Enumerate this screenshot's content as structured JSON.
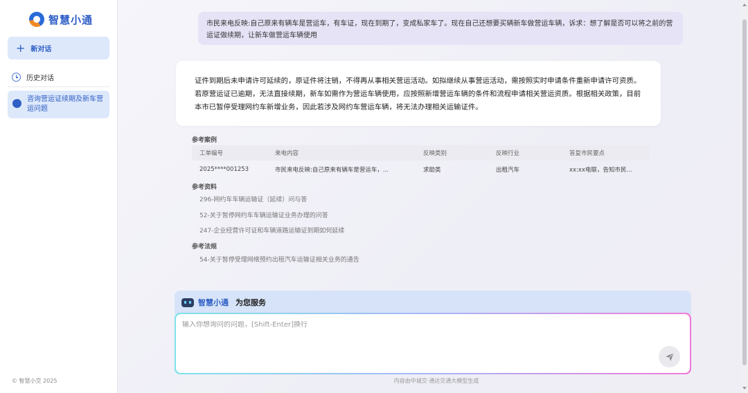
{
  "sidebar": {
    "logo_text": "智慧小通",
    "new_chat_label": "新对话",
    "history_label": "历史对话",
    "conversations": [
      {
        "label": "咨询营运证续期及新车营运问题"
      }
    ],
    "copyright": "© 智慧小交 2025"
  },
  "chat": {
    "user_message": "市民来电反映:自己原来有辆车是营运车，有车证，现在到期了，变成私家车了。现在自己还想要买辆新车做营运车辆，诉求：想了解是否可以将之前的营运证做续期，让新车做营运车辆使用",
    "ai_message": "证件到期后未申请许可延续的，原证件将注销，不得再从事相关营运活动。如拟继续从事营运活动，需按照实时申请条件重新申请许可资质。若原营运证已逾期，无法直接续期，新车如需作为营运车辆使用，应按照新增营运车辆的条件和流程申请相关营运资质。根据相关政策，目前本市已暂停受理网约车新增业务，因此若涉及网约车营运车辆，将无法办理相关运输证件。"
  },
  "references": {
    "cases_title": "参考案例",
    "table_headers": [
      "工单编号",
      "来电内容",
      "反映类别",
      "反映行业",
      "答复市民要点"
    ],
    "table_rows": [
      [
        "2025****001253",
        "市民来电反映:自己原来有辆车是营运车，...",
        "求助类",
        "出租汽车",
        "xx:xx电联，告知市民..."
      ]
    ],
    "materials_title": "参考资料",
    "materials": [
      "296-网约车车辆运输证（延续）问与答",
      "52-关于暂停网约车车辆运输证业务办理的问答",
      "247-企业经营许可证和车辆道路运输证到期如何延续"
    ],
    "regulations_title": "参考法规",
    "regulations": [
      "54-关于暂停受理网络预约出租汽车运输证相关业务的通告"
    ]
  },
  "composer": {
    "brand": "智慧小通",
    "serve_text": "为您服务",
    "placeholder": "输入你想询问的问题，[Shift-Enter]换行"
  },
  "footer_note": "内容由中城交·通达交通大模型生成",
  "colors": {
    "accent": "#2f5fc4",
    "sidebar_active": "#dde8fb",
    "user_bubble": "#e6e3f6"
  }
}
